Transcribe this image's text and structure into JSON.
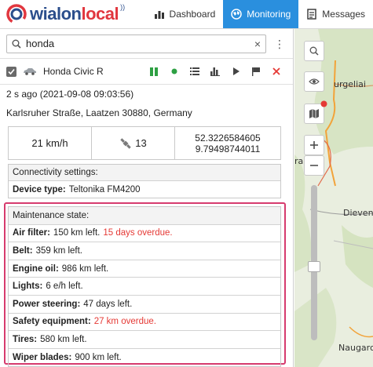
{
  "header": {
    "logo_brand": "wialon",
    "logo_local": "local",
    "nav": [
      {
        "label": "Dashboard",
        "icon": "bar-chart-icon",
        "active": false
      },
      {
        "label": "Monitoring",
        "icon": "globe-icon",
        "active": true
      },
      {
        "label": "Messages",
        "icon": "document-icon",
        "active": false
      }
    ],
    "accent": "#2a8fde"
  },
  "search": {
    "value": "honda",
    "placeholder": "",
    "clear": "×",
    "menu": "⋮"
  },
  "unit": {
    "name": "Honda Civic R",
    "checked": true,
    "actions": [
      "signal-icon",
      "status-dot-icon",
      "list-icon",
      "chart-icon",
      "play-icon",
      "flag-icon",
      "delete-icon"
    ]
  },
  "info": {
    "last_message": "2 s ago (2021-09-08 09:03:56)",
    "address": "Karlsruher Straße, Laatzen 30880, Germany",
    "speed": "21 km/h",
    "satellites": "13",
    "lat": "52.3226584605",
    "lon": "9.79498744011"
  },
  "connectivity": {
    "title": "Connectivity settings:",
    "device_label": "Device type:",
    "device_value": "Teltonika FM4200"
  },
  "maintenance": {
    "title": "Maintenance state:",
    "items": [
      {
        "label": "Air filter:",
        "value": "150 km left.",
        "overdue": "15 days overdue."
      },
      {
        "label": "Belt:",
        "value": "359 km left.",
        "overdue": ""
      },
      {
        "label": "Engine oil:",
        "value": "986 km left.",
        "overdue": ""
      },
      {
        "label": "Lights:",
        "value": "6 e/h left.",
        "overdue": ""
      },
      {
        "label": "Power steering:",
        "value": "47 days left.",
        "overdue": ""
      },
      {
        "label": "Safety equipment:",
        "value": "",
        "overdue": "27 km overdue."
      },
      {
        "label": "Tires:",
        "value": "580 km left.",
        "overdue": ""
      },
      {
        "label": "Wiper blades:",
        "value": "900 km left.",
        "overdue": ""
      }
    ]
  },
  "map": {
    "labels": [
      "urgeliai",
      "rai",
      "Dieven",
      "Naugarc"
    ],
    "controls": [
      "search-icon",
      "eye-icon",
      "map-layers-icon",
      "zoom-in-icon",
      "zoom-out-icon"
    ]
  },
  "colors": {
    "overdue": "#e53935",
    "highlight": "#d63b6e",
    "online": "#2ea043"
  }
}
